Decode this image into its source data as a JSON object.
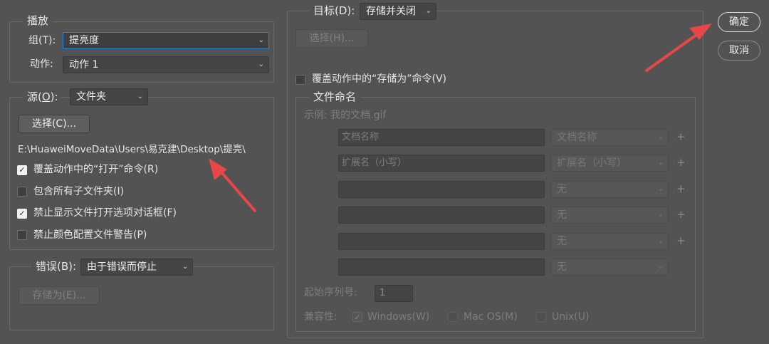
{
  "play": {
    "legend": "播放",
    "group_label": "组(T):",
    "group_label_key": "T",
    "group_value": "提亮度",
    "action_label": "动作:",
    "action_value": "动作 1"
  },
  "source": {
    "label_prefix": "源(",
    "label_key": "O",
    "label_suffix": "):",
    "value": "文件夹",
    "choose_button": "选择(C)...",
    "path": "E:\\HuaweiMoveData\\Users\\易克建\\Desktop\\提亮\\",
    "options": [
      {
        "label": "覆盖动作中的“打开”命令(R)",
        "checked": true
      },
      {
        "label": "包含所有子文件夹(I)",
        "checked": false
      },
      {
        "label": "禁止显示文件打开选项对话框(F)",
        "checked": true
      },
      {
        "label": "禁止颜色配置文件警告(P)",
        "checked": false
      }
    ]
  },
  "errors": {
    "label": "错误(B):",
    "value": "由于错误而停止",
    "save_as_button": "存储为(E)..."
  },
  "target": {
    "label": "目标(D):",
    "value": "存储并关闭",
    "choose_button": "选择(H)...",
    "override_save": {
      "label": "覆盖动作中的“存储为”命令(V)",
      "checked": false
    },
    "naming": {
      "legend": "文件命名",
      "example": "示例: 我的文档.gif",
      "rows": [
        {
          "field": "文档名称",
          "select": "文档名称",
          "plus": "+"
        },
        {
          "field": "扩展名（小写）",
          "select": "扩展名（小写）",
          "plus": "+"
        },
        {
          "field": "",
          "select": "无",
          "plus": "+"
        },
        {
          "field": "",
          "select": "无",
          "plus": "+"
        },
        {
          "field": "",
          "select": "无",
          "plus": "+"
        },
        {
          "field": "",
          "select": "无",
          "plus": ""
        }
      ],
      "serial_label": "起始序列号:",
      "serial_value": "1",
      "compat_label": "兼容性:",
      "compat": [
        {
          "label": "Windows(W)",
          "checked": true
        },
        {
          "label": "Mac OS(M)",
          "checked": false
        },
        {
          "label": "Unix(U)",
          "checked": false
        }
      ]
    }
  },
  "buttons": {
    "ok": "确定",
    "cancel": "取消"
  },
  "colors": {
    "background": "#535353",
    "annotation_arrow": "#e8474a",
    "focus_border": "#1e88e5"
  }
}
